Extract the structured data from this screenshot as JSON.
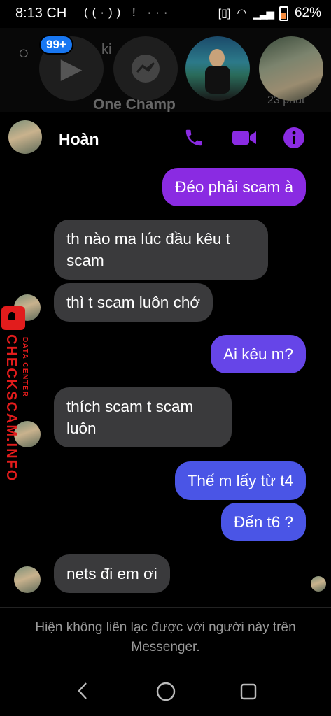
{
  "status_bar": {
    "time": "8:13 CH",
    "left_icons": [
      "signal-hotspot-icon",
      "alert-icon",
      "more-icon"
    ],
    "battery_percent": "62%"
  },
  "background_list": {
    "badge": "99+",
    "search_placeholder": "ki",
    "chat_name": "One Champ",
    "time_ago": "23 phút"
  },
  "header": {
    "contact_name": "Hoàn",
    "accent_color": "#8a2be2"
  },
  "messages": [
    {
      "side": "out",
      "text": "Đéo phải scam à"
    },
    {
      "side": "in",
      "text": "th nào ma lúc đầu kêu t scam"
    },
    {
      "side": "in",
      "text": "thì t scam luôn chớ"
    },
    {
      "side": "out",
      "text": "Ai kêu m?"
    },
    {
      "side": "in",
      "text": "thích scam t scam luôn"
    },
    {
      "side": "out",
      "text": "Thế m lấy từ t4"
    },
    {
      "side": "out",
      "text": "Đến t6 ?"
    },
    {
      "side": "in",
      "text": "nets đi em ơi"
    }
  ],
  "watermark": {
    "brand": "CHECKSCAM.INFO",
    "tagline": "DATA CENTER"
  },
  "footer": {
    "notice": "Hiện không liên lạc được với người này trên Messenger."
  }
}
